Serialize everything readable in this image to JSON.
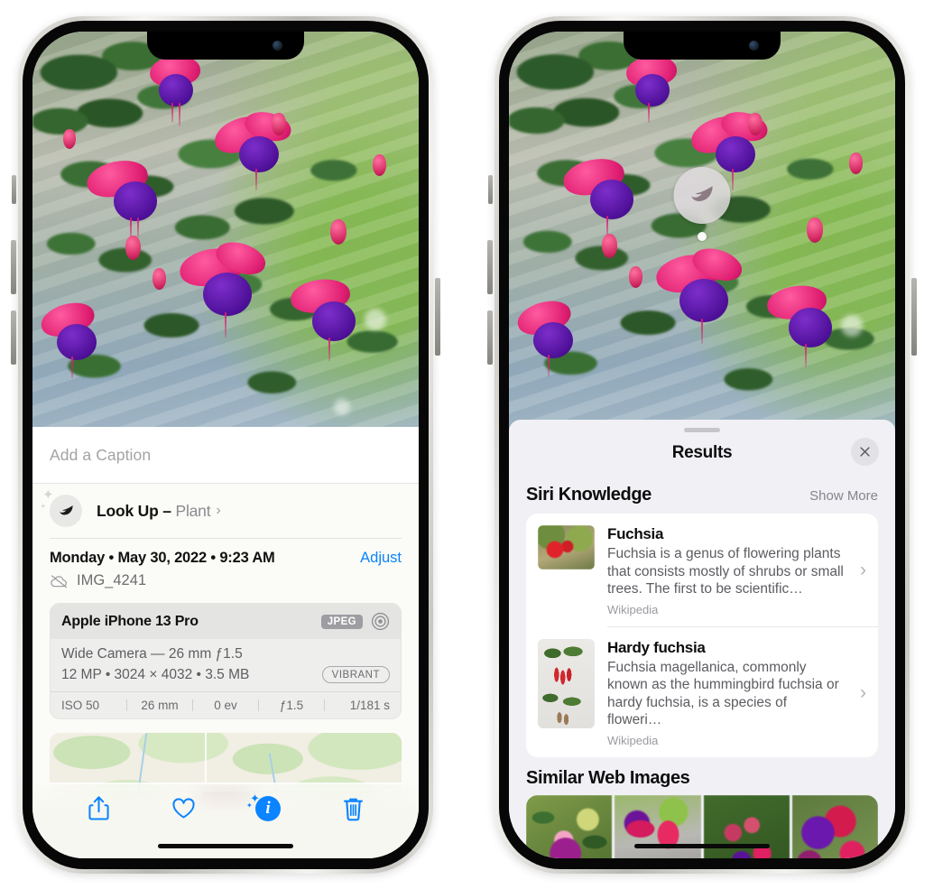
{
  "left_phone": {
    "photo": {
      "alt_name": "fuchsia-plant-photo"
    },
    "caption_field": {
      "placeholder": "Add a Caption",
      "value": ""
    },
    "lookup_row": {
      "icon": "leaf-icon",
      "label": "Look Up –",
      "subject": "Plant",
      "chevron": "›"
    },
    "datetime": {
      "line": "Monday • May 30, 2022 • 9:23 AM",
      "adjust_label": "Adjust",
      "filename": "IMG_4241",
      "cloud_icon": "icloud-slash-icon"
    },
    "meta_card": {
      "device": "Apple iPhone 13 Pro",
      "format_badge": "JPEG",
      "aperture_icon": "aperture-icon",
      "lens_line": "Wide Camera — 26 mm ƒ1.5",
      "specs_line": "12 MP • 3024 × 4032 • 3.5 MB",
      "style_badge": "VIBRANT",
      "exif": [
        "ISO 50",
        "26 mm",
        "0 ev",
        "ƒ1.5",
        "1/181 s"
      ]
    },
    "map": {
      "name": "location-map-thumbnail"
    },
    "toolbar": [
      {
        "name": "share-button",
        "icon": "share-icon"
      },
      {
        "name": "favorite-button",
        "icon": "heart-icon"
      },
      {
        "name": "info-button",
        "icon": "info-sparkle-icon"
      },
      {
        "name": "delete-button",
        "icon": "trash-icon"
      }
    ]
  },
  "right_phone": {
    "photo": {
      "alt_name": "fuchsia-plant-photo"
    },
    "visual_lookup_badge": {
      "icon": "leaf-icon"
    },
    "sheet": {
      "title": "Results",
      "close_icon": "close-icon",
      "sections": [
        {
          "title": "Siri Knowledge",
          "action": "Show More",
          "items": [
            {
              "title": "Fuchsia",
              "description": "Fuchsia is a genus of flowering plants that consists mostly of shrubs or small trees. The first to be scientific…",
              "source": "Wikipedia",
              "chevron": "›",
              "thumb": "fuchsia-red-flowers-thumb"
            },
            {
              "title": "Hardy fuchsia",
              "description": "Fuchsia magellanica, commonly known as the hummingbird fuchsia or hardy fuchsia, is a species of floweri…",
              "source": "Wikipedia",
              "chevron": "›",
              "thumb": "hardy-fuchsia-branch-thumb"
            }
          ]
        },
        {
          "title": "Similar Web Images",
          "tiles": [
            "web-image-1",
            "web-image-2",
            "web-image-3",
            "web-image-4"
          ]
        }
      ]
    }
  },
  "colors": {
    "accent_blue": "#0a84ff",
    "sheet_bg": "#f1f0f5",
    "card_bg": "#ffffff",
    "info_bg": "#fbfbf7"
  }
}
